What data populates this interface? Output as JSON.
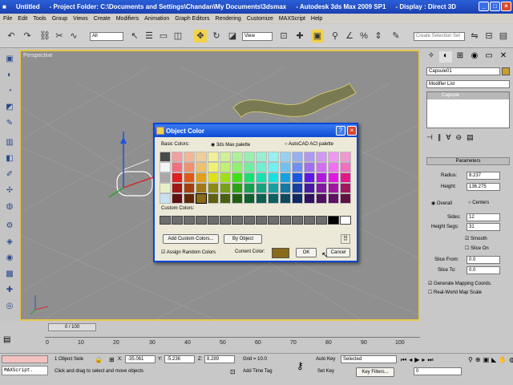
{
  "titlebar": {
    "app": "Untitled",
    "folder": "- Project Folder: C:\\Documents and Settings\\Chandan\\My Documents\\3dsmax",
    "product": "- Autodesk 3ds Max  2009 SP1",
    "display": "- Display : Direct 3D"
  },
  "menu": [
    "File",
    "Edit",
    "Tools",
    "Group",
    "Views",
    "Create",
    "Modifiers",
    "Animation",
    "Graph Editors",
    "Rendering",
    "Customize",
    "MAXScript",
    "Help"
  ],
  "toolbar": {
    "filter": "All",
    "refcoord": "View",
    "selset": "Create Selection Set"
  },
  "viewport": {
    "label": "Perspective"
  },
  "cmdpanel": {
    "object_name": "Capsule01",
    "modifier_list": "Modifier List",
    "stack_item": "Capsule",
    "rollout": "Parameters",
    "radius_label": "Radius:",
    "radius": "8.237",
    "height_label": "Height:",
    "height": "136.275",
    "overall": "Overall",
    "centers": "Centers",
    "sides_label": "Sides:",
    "sides": "12",
    "hsegs_label": "Height Segs:",
    "hsegs": "31",
    "smooth": "Smooth",
    "slice_on": "Slice On",
    "slice_from_label": "Slice From:",
    "slice_from": "0.0",
    "slice_to_label": "Slice To:",
    "slice_to": "0.0",
    "gen_map": "Generate Mapping Coords.",
    "realworld": "Real-World Map Scale"
  },
  "dialog": {
    "title": "Object Color",
    "basic_colors": "Basic Colors:",
    "max_palette": "3ds Max palette",
    "acad_palette": "AutoCAD ACI palette",
    "custom_colors": "Custom Colors:",
    "add_custom": "Add Custom Colors...",
    "by_object": "By Object",
    "assign_random": "Assign Random Colors",
    "current_color": "Current Color:",
    "ok": "OK",
    "cancel": "Cancel",
    "current_hex": "#8a6b1a"
  },
  "palette": [
    [
      "#4a4a4a",
      "#f0a0a0",
      "#f0b898",
      "#f0d098",
      "#f0f098",
      "#d0f098",
      "#b0f098",
      "#98f0b0",
      "#98f0d0",
      "#98f0f0",
      "#98d0f0",
      "#98b0f0",
      "#b098f0",
      "#d098f0",
      "#f098f0",
      "#f098d0"
    ],
    [
      "#f4f4f4",
      "#f07080",
      "#f09070",
      "#f0c070",
      "#f0f070",
      "#c0f070",
      "#90f070",
      "#70f0a0",
      "#70f0d0",
      "#70f0f0",
      "#70c0f0",
      "#7090f0",
      "#a070f0",
      "#d070f0",
      "#f070f0",
      "#f070c0"
    ],
    [
      "#a8a8a8",
      "#e02020",
      "#e05818",
      "#e0a018",
      "#e0e018",
      "#a0e018",
      "#40e018",
      "#18e070",
      "#18e0b0",
      "#18e0e0",
      "#18a0e0",
      "#1858e0",
      "#6018e0",
      "#b018e0",
      "#e018e0",
      "#e01888"
    ],
    [
      "#e8f0c8",
      "#a01818",
      "#a04010",
      "#a07818",
      "#8a8a18",
      "#78a018",
      "#30a018",
      "#18a050",
      "#18a080",
      "#18a0a0",
      "#1878a0",
      "#1840a0",
      "#4818a0",
      "#8018a0",
      "#a018a0",
      "#a01860"
    ],
    [
      "#c8e0f0",
      "#601010",
      "#602808",
      "#8a6b1a",
      "#606010",
      "#486010",
      "#206010",
      "#106030",
      "#106050",
      "#106060",
      "#104860",
      "#102860",
      "#301060",
      "#501060",
      "#601060",
      "#601040"
    ]
  ],
  "timeline": {
    "frame": "0 / 100",
    "ticks": [
      "0",
      "10",
      "20",
      "30",
      "40",
      "50",
      "60",
      "70",
      "80",
      "90",
      "100"
    ]
  },
  "status": {
    "maxscript": "MAXScript.",
    "selected": "1 Object Sele",
    "x_label": "X:",
    "x": "-35.061",
    "y_label": "Y:",
    "y": "-5.236",
    "z_label": "Z:",
    "z": "8.289",
    "grid": "Grid = 10.0",
    "prompt": "Click and drag to select and move objects",
    "add_tag": "Add Time Tag",
    "autokey": "Auto Key",
    "setkey": "Set Key",
    "key_mode": "Selected",
    "key_filters": "Key Filters...",
    "frame": "0"
  }
}
